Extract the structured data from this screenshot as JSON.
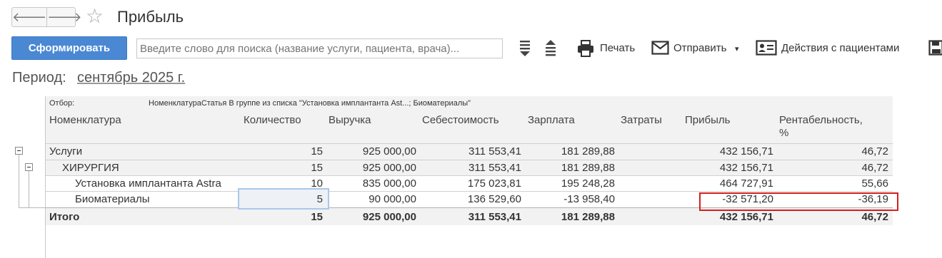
{
  "window": {
    "back_glyph": "🡐",
    "forward_glyph": "🡒",
    "title": "Прибыль"
  },
  "toolbar": {
    "generate_label": "Сформировать",
    "search_placeholder": "Введите слово для поиска (название услуги, пациента, врача)...",
    "print_label": "Печать",
    "send_label": "Отправить",
    "send_dropdown": "▾",
    "patient_actions_label": "Действия с пациентами"
  },
  "period": {
    "label": "Период:",
    "value": "сентябрь 2025 г."
  },
  "report": {
    "filter_label": "Отбор:",
    "filter_value": "НоменклатураСтатья В группе из списка \"Установка имплантанта Ast...; Биоматериалы\"",
    "columns": [
      "Номенклатура",
      "Количество",
      "Выручка",
      "Себестоимость",
      "Зарплата",
      "Затраты",
      "Прибыль",
      "Рентабельность,",
      "%"
    ],
    "rows": [
      {
        "name": "Услуги",
        "qty": "15",
        "revenue": "925 000,00",
        "cost": "311 553,41",
        "salary": "181 289,88",
        "expenses": "",
        "profit": "432 156,71",
        "margin": "46,72"
      },
      {
        "name": "ХИРУРГИЯ",
        "qty": "15",
        "revenue": "925 000,00",
        "cost": "311 553,41",
        "salary": "181 289,88",
        "expenses": "",
        "profit": "432 156,71",
        "margin": "46,72"
      },
      {
        "name": "Установка имплантанта Astra",
        "qty": "10",
        "revenue": "835 000,00",
        "cost": "175 023,81",
        "salary": "195 248,28",
        "expenses": "",
        "profit": "464 727,91",
        "margin": "55,66"
      },
      {
        "name": "Биоматериалы",
        "qty": "5",
        "revenue": "90 000,00",
        "cost": "136 529,60",
        "salary": "-13 958,40",
        "expenses": "",
        "profit": "-32 571,20",
        "margin": "-36,19"
      }
    ],
    "total": {
      "name": "Итого",
      "qty": "15",
      "revenue": "925 000,00",
      "cost": "311 553,41",
      "salary": "181 289,88",
      "expenses": "",
      "profit": "432 156,71",
      "margin": "46,72"
    }
  },
  "colors": {
    "primary_button": "#4a88d4",
    "highlight_border": "#d42020",
    "selected_cell_border": "#a9c8e9"
  },
  "icons": [
    "arrow-left-icon",
    "arrow-right-icon",
    "star-icon",
    "expand-all-icon",
    "collapse-all-icon",
    "printer-icon",
    "envelope-icon",
    "id-card-icon",
    "save-icon",
    "tree-collapse-icon"
  ]
}
